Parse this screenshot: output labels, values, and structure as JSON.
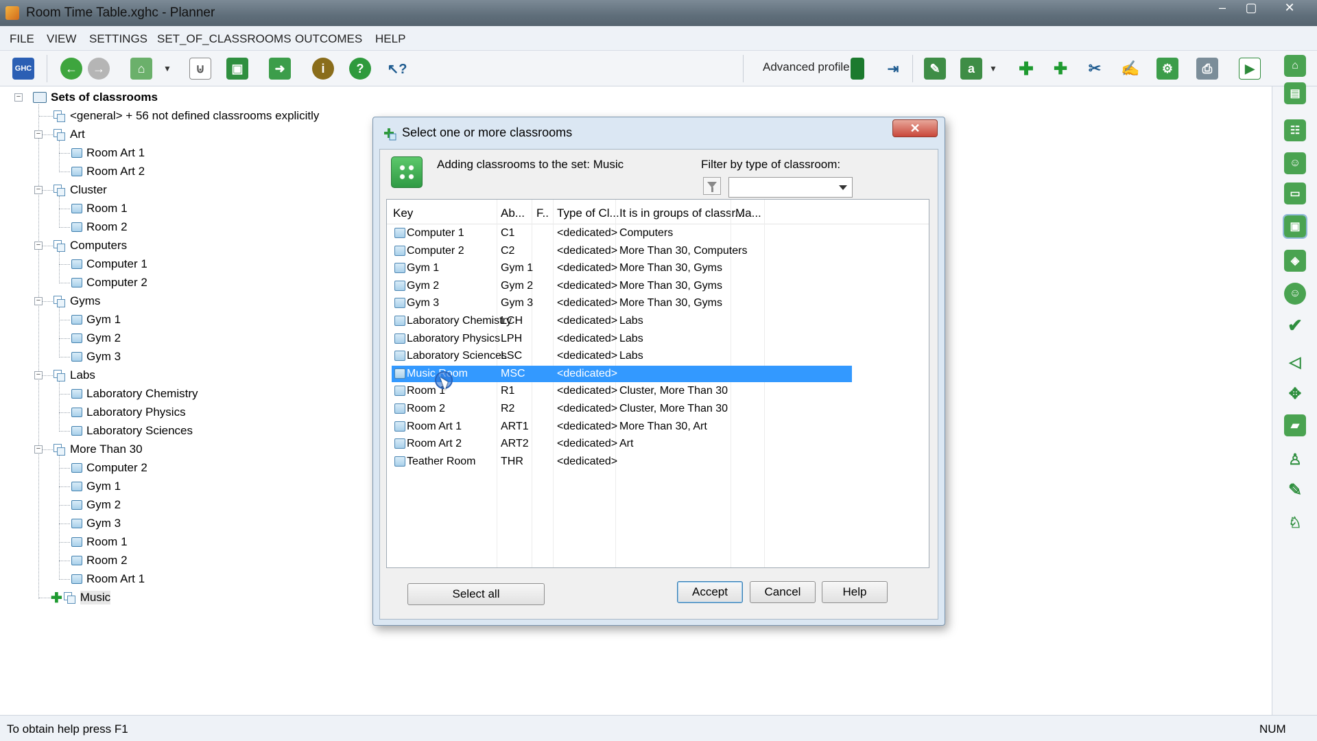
{
  "window": {
    "title": "Room Time Table.xghc - Planner",
    "controls": [
      "–",
      "▢",
      "✕"
    ]
  },
  "menu": [
    "FILE",
    "VIEW",
    "SETTINGS",
    "SET_OF_CLASSROOMS",
    "OUTCOMES",
    "HELP"
  ],
  "toolbar": {
    "profile_label": "Advanced profile",
    "icons": [
      "ghc-logo-icon",
      "back-icon",
      "forward-icon",
      "home-icon",
      "dropdown-icon",
      "attach-icon",
      "save-icon",
      "export-icon",
      "info-icon",
      "help-icon",
      "context-help-icon",
      "profile-icon",
      "arrows-icon",
      "classroom-edit-icon",
      "user-edit-icon",
      "add-icon",
      "add-multiple-icon",
      "cut-icon",
      "pen-icon",
      "set-icon",
      "print-icon",
      "run-icon"
    ]
  },
  "tree": {
    "root": "Sets of classrooms",
    "nodes": [
      {
        "level": 1,
        "type": "set",
        "label": "<general> + 56 not defined classrooms explicitly"
      },
      {
        "level": 1,
        "type": "set",
        "label": "Art",
        "expanded": true
      },
      {
        "level": 2,
        "type": "room",
        "label": "Room Art 1"
      },
      {
        "level": 2,
        "type": "room",
        "label": "Room Art 2"
      },
      {
        "level": 1,
        "type": "set",
        "label": "Cluster",
        "expanded": true
      },
      {
        "level": 2,
        "type": "room",
        "label": "Room 1"
      },
      {
        "level": 2,
        "type": "room",
        "label": "Room 2"
      },
      {
        "level": 1,
        "type": "set",
        "label": "Computers",
        "expanded": true
      },
      {
        "level": 2,
        "type": "room",
        "label": "Computer 1"
      },
      {
        "level": 2,
        "type": "room",
        "label": "Computer 2"
      },
      {
        "level": 1,
        "type": "set",
        "label": "Gyms",
        "expanded": true
      },
      {
        "level": 2,
        "type": "room",
        "label": "Gym 1"
      },
      {
        "level": 2,
        "type": "room",
        "label": "Gym 2"
      },
      {
        "level": 2,
        "type": "room",
        "label": "Gym 3"
      },
      {
        "level": 1,
        "type": "set",
        "label": "Labs",
        "expanded": true
      },
      {
        "level": 2,
        "type": "room",
        "label": "Laboratory Chemistry"
      },
      {
        "level": 2,
        "type": "room",
        "label": "Laboratory Physics"
      },
      {
        "level": 2,
        "type": "room",
        "label": "Laboratory Sciences"
      },
      {
        "level": 1,
        "type": "set",
        "label": "More Than 30",
        "expanded": true
      },
      {
        "level": 2,
        "type": "room",
        "label": "Computer 2"
      },
      {
        "level": 2,
        "type": "room",
        "label": "Gym 1"
      },
      {
        "level": 2,
        "type": "room",
        "label": "Gym 2"
      },
      {
        "level": 2,
        "type": "room",
        "label": "Gym 3"
      },
      {
        "level": 2,
        "type": "room",
        "label": "Room 1"
      },
      {
        "level": 2,
        "type": "room",
        "label": "Room 2"
      },
      {
        "level": 2,
        "type": "room",
        "label": "Room Art 1"
      },
      {
        "level": 1,
        "type": "set-new",
        "label": "Music"
      }
    ]
  },
  "dialog": {
    "title": "Select one or more classrooms",
    "close": "✕",
    "adding_text": "Adding classrooms to the set: Music",
    "filter_label": "Filter by type of classroom:",
    "filter_value": "",
    "columns": [
      "Key",
      "Ab...",
      "F..",
      "Type of Cl...",
      "It is in groups of classr...",
      "Ma..."
    ],
    "rows": [
      {
        "key": "Computer 1",
        "abbr": "C1",
        "f": "",
        "type": "<dedicated>",
        "groups": "Computers",
        "ma": ""
      },
      {
        "key": "Computer 2",
        "abbr": "C2",
        "f": "",
        "type": "<dedicated>",
        "groups": "More Than 30, Computers",
        "ma": ""
      },
      {
        "key": "Gym 1",
        "abbr": "Gym 1",
        "f": "",
        "type": "<dedicated>",
        "groups": "More Than 30, Gyms",
        "ma": ""
      },
      {
        "key": "Gym 2",
        "abbr": "Gym 2",
        "f": "",
        "type": "<dedicated>",
        "groups": "More Than 30, Gyms",
        "ma": ""
      },
      {
        "key": "Gym 3",
        "abbr": "Gym 3",
        "f": "",
        "type": "<dedicated>",
        "groups": "More Than 30, Gyms",
        "ma": ""
      },
      {
        "key": "Laboratory Chemistry",
        "abbr": "LCH",
        "f": "",
        "type": "<dedicated>",
        "groups": "Labs",
        "ma": ""
      },
      {
        "key": "Laboratory Physics",
        "abbr": "LPH",
        "f": "",
        "type": "<dedicated>",
        "groups": "Labs",
        "ma": ""
      },
      {
        "key": "Laboratory Sciences",
        "abbr": "LSC",
        "f": "",
        "type": "<dedicated>",
        "groups": "Labs",
        "ma": ""
      },
      {
        "key": "Music Room",
        "abbr": "MSC",
        "f": "",
        "type": "<dedicated>",
        "groups": "",
        "ma": "",
        "selected": true
      },
      {
        "key": "Room 1",
        "abbr": "R1",
        "f": "",
        "type": "<dedicated>",
        "groups": "Cluster, More Than 30",
        "ma": ""
      },
      {
        "key": "Room 2",
        "abbr": "R2",
        "f": "",
        "type": "<dedicated>",
        "groups": "Cluster, More Than 30",
        "ma": ""
      },
      {
        "key": "Room Art 1",
        "abbr": "ART1",
        "f": "",
        "type": "<dedicated>",
        "groups": "More Than 30, Art",
        "ma": ""
      },
      {
        "key": "Room Art 2",
        "abbr": "ART2",
        "f": "",
        "type": "<dedicated>",
        "groups": "Art",
        "ma": ""
      },
      {
        "key": "Teather Room",
        "abbr": "THR",
        "f": "",
        "type": "<dedicated>",
        "groups": "",
        "ma": ""
      }
    ],
    "buttons": {
      "select_all": "Select all",
      "accept": "Accept",
      "cancel": "Cancel",
      "help": "Help"
    }
  },
  "status": {
    "help": "To obtain help press F1",
    "num": "NUM"
  },
  "colors": {
    "selection": "#3399ff",
    "titlebar": "#5f6e7a",
    "dialog_bg": "#dbe7f3"
  }
}
